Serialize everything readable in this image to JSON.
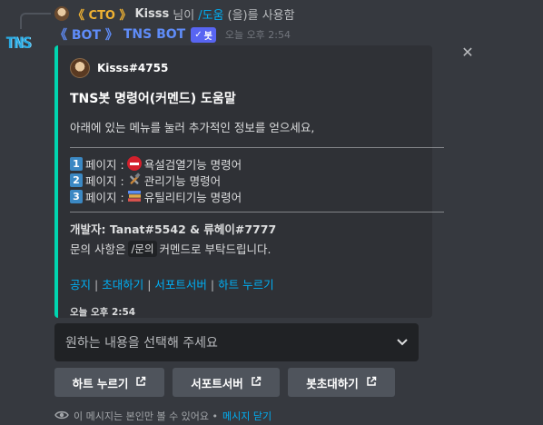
{
  "reply": {
    "role": "《 CTO 》",
    "username": "Kisss",
    "suffix_1": "님이",
    "command": "/도움",
    "suffix_2": "(을)를 사용함"
  },
  "bot": {
    "avatar_text": "TNS",
    "role": "《 BOT 》",
    "name": "TNS BOT",
    "tag_check": "✓",
    "tag_label": "봇",
    "timestamp": "오늘 오후 2:54"
  },
  "embed": {
    "accent": "#00d5b0",
    "author": "Kisss#4755",
    "title": "TNS봇 명령어(커멘드) 도움말",
    "description": "아래에 있는 메뉴를 눌러 추가적인 정보를 얻으세요,",
    "pages": [
      {
        "num": "1",
        "prefix": "페이지 :",
        "icon": "no-entry-icon",
        "text": "욕설검열기능 명령어"
      },
      {
        "num": "2",
        "prefix": "페이지 :",
        "icon": "hammer-wrench-icon",
        "text": "관리기능 명령어"
      },
      {
        "num": "3",
        "prefix": "페이지 :",
        "icon": "books-icon",
        "text": "유틸리티기능 명령어"
      }
    ],
    "developers": "개발자: Tanat#5542 & 류헤이#7777",
    "inquiry_before": "문의 사항은",
    "inquiry_cmd": "/문의",
    "inquiry_after": "커멘드로 부탁드립니다.",
    "links": [
      "공지",
      "초대하기",
      "서포트서버",
      "하트 누르기"
    ],
    "link_separator": "|",
    "footer": "오늘 오후 2:54"
  },
  "select": {
    "placeholder": "원하는 내용을 선택해 주세요"
  },
  "buttons": [
    {
      "label": "하트 누르기"
    },
    {
      "label": "서포트서버"
    },
    {
      "label": "봇초대하기"
    }
  ],
  "ephemeral": {
    "text": "이 메시지는 본인만 볼 수 있어요 •",
    "dismiss": "메시지 닫기"
  }
}
